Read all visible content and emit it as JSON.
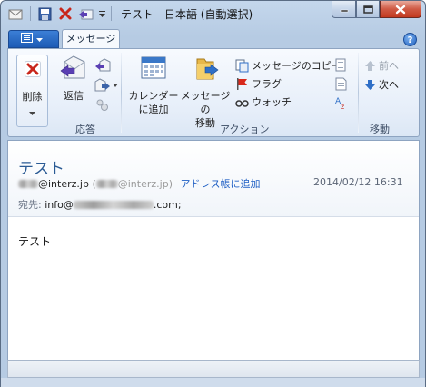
{
  "window": {
    "title": "テスト - 日本語 (自動選択)"
  },
  "ribbon": {
    "file_tab": "",
    "active_tab": "メッセージ",
    "groups": {
      "delete": {
        "button": "削除"
      },
      "respond": {
        "label": "応答",
        "reply": "返信"
      },
      "actions": {
        "label": "アクション",
        "calendar": [
          "カレンダー",
          "に追加"
        ],
        "move": [
          "メッセージの",
          "移動"
        ],
        "copy": "メッセージのコピー",
        "flag": "フラグ",
        "watch": "ウォッチ"
      },
      "move_group": {
        "label": "移動",
        "prev": "前へ",
        "next": "次へ"
      }
    }
  },
  "message": {
    "subject": "テスト",
    "from_domain": "@interz.jp",
    "from_alt_domain": "@interz.jp",
    "add_to_contacts": "アドレス帳に追加",
    "date": "2014/02/12 16:31",
    "to_label": "宛先:",
    "to_prefix": "info@",
    "to_suffix": ".com;",
    "body": "テスト"
  },
  "colors": {
    "accent": "#1d5bb5",
    "subject": "#2a5a94",
    "link": "#1f5fc4"
  }
}
